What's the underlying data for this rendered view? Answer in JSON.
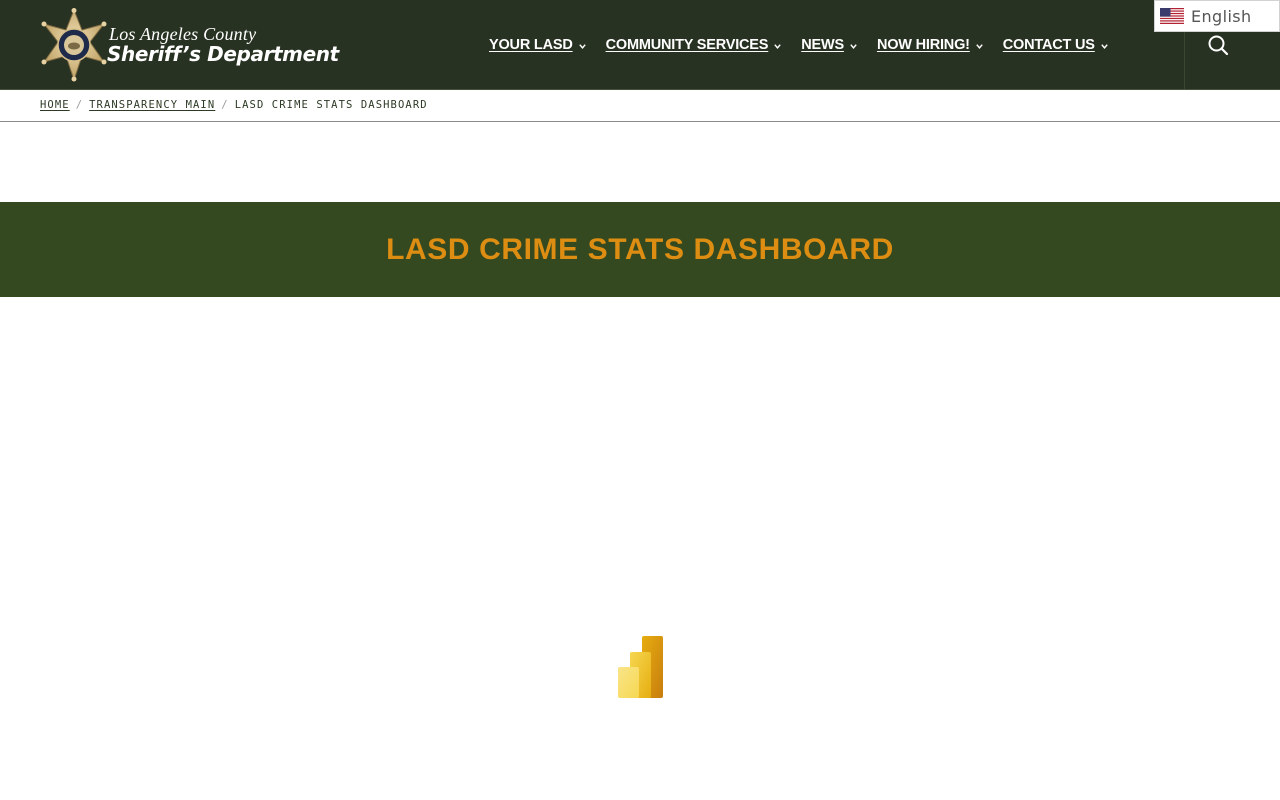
{
  "header": {
    "logo": {
      "line1": "Los Angeles County",
      "line2": "Sheriff’s Department",
      "badge_icon": "sheriff-star-badge"
    },
    "nav": [
      {
        "label": "YOUR LASD"
      },
      {
        "label": "COMMUNITY SERVICES"
      },
      {
        "label": "NEWS"
      },
      {
        "label": "NOW HIRING!"
      },
      {
        "label": "CONTACT US"
      }
    ],
    "search_icon": "search-icon",
    "language": {
      "label": "English",
      "flag_icon": "us-flag-icon"
    },
    "colors": {
      "background": "#283222",
      "nav_text": "#ffffff"
    }
  },
  "breadcrumb": {
    "items": [
      {
        "label": "HOME"
      },
      {
        "label": "TRANSPARENCY MAIN"
      }
    ],
    "separator": "/",
    "current": "LASD CRIME STATS DASHBOARD"
  },
  "banner": {
    "title": "LASD CRIME STATS DASHBOARD",
    "colors": {
      "background": "#354920",
      "title": "#dd8e12"
    }
  },
  "report": {
    "loading_icon": "power-bi-logo-icon"
  }
}
